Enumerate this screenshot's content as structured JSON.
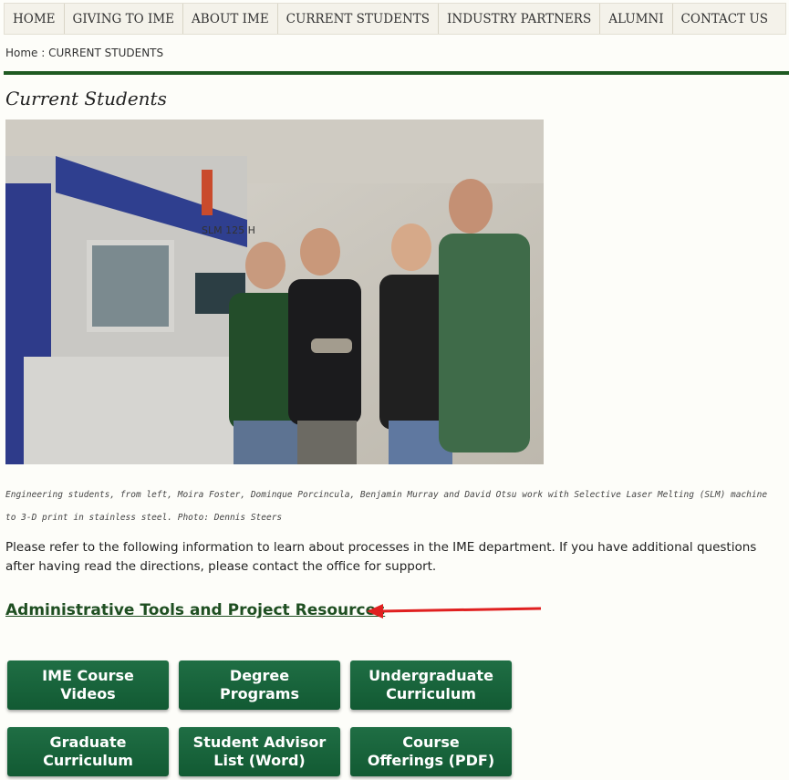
{
  "nav": {
    "items": [
      "HOME",
      "GIVING TO IME",
      "ABOUT IME",
      "CURRENT STUDENTS",
      "INDUSTRY PARTNERS",
      "ALUMNI",
      "CONTACT US"
    ]
  },
  "breadcrumb": "Home : CURRENT STUDENTS",
  "page_title": "Current Students",
  "photo": {
    "machine_label": "SLM 125 H"
  },
  "caption": "Engineering students, from left, Moira Foster, Dominque Porcincula, Benjamin Murray and David Otsu work with Selective Laser Melting (SLM) machine to 3-D print in stainless steel. Photo: Dennis Steers",
  "intro": "Please refer to the following information to learn about processes in the IME department. If you have additional questions after having read the directions, please contact the office for support.",
  "section_link": "Administrative Tools and Project Resources",
  "annotation": {
    "arrow_color": "#e02020"
  },
  "buttons": [
    "IME Course Videos",
    "Degree Programs",
    "Undergraduate Curriculum",
    "Graduate Curriculum",
    "Student Advisor List (Word)",
    "Course Offerings (PDF)"
  ]
}
